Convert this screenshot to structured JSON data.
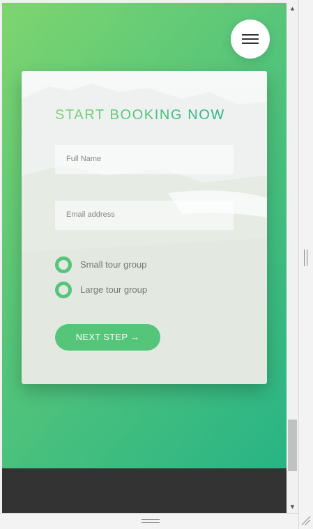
{
  "menu": {
    "icon": "hamburger-menu-icon"
  },
  "booking_form": {
    "heading": "START BOOKING NOW",
    "full_name": {
      "placeholder": "Full Name",
      "value": ""
    },
    "email": {
      "placeholder": "Email address",
      "value": ""
    },
    "group_options": [
      {
        "label": "Small tour group",
        "selected": false
      },
      {
        "label": "Large tour group",
        "selected": false
      }
    ],
    "next_button": "NEXT STEP →"
  },
  "colors": {
    "gradient_start": "#7ed56f",
    "gradient_mid": "#55c57a",
    "gradient_end": "#28b485",
    "footer": "#333333"
  },
  "scrollbar": {
    "up_icon": "scroll-up-arrow-icon",
    "down_icon": "scroll-down-arrow-icon"
  }
}
